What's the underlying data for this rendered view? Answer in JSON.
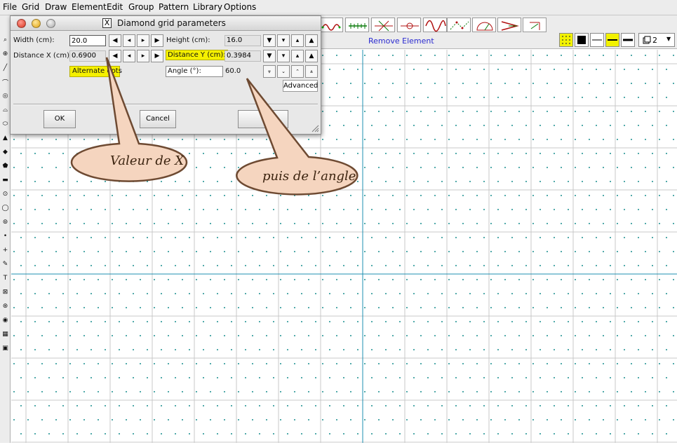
{
  "menu": [
    {
      "label": "File",
      "name": "menu-file"
    },
    {
      "label": "Grid",
      "name": "menu-grid"
    },
    {
      "label": "Draw",
      "name": "menu-draw"
    },
    {
      "label": "Element",
      "name": "menu-element"
    },
    {
      "label": "Edit",
      "name": "menu-edit"
    },
    {
      "label": "Group",
      "name": "menu-group"
    },
    {
      "label": "Pattern",
      "name": "menu-pattern"
    },
    {
      "label": "Library",
      "name": "menu-library"
    },
    {
      "label": "Options",
      "name": "menu-options"
    }
  ],
  "toolbar": {
    "remove_element": "Remove Element",
    "layer_value": "2",
    "tool_icons": [
      "wave-path-icon",
      "measure-ruler-icon",
      "scissors-cross-icon",
      "circle-point-icon",
      "sine-wave-icon",
      "dotted-path-icon",
      "protractor-icon",
      "arrow-shape-icon",
      "arrow-snap-icon"
    ],
    "line_styles": [
      "dot-grid-style-icon",
      "solid-fill-style-icon",
      "thin-line-style-icon",
      "highlight-line-style-icon",
      "thick-line-style-icon"
    ]
  },
  "left_tools": [
    "zoom-icon",
    "select-icon",
    "line-icon",
    "curve-icon",
    "spiral-icon",
    "arc-icon",
    "ellipse-icon",
    "triangle-icon",
    "diamond-icon",
    "polygon-icon",
    "rectangle-icon",
    "circle-icon",
    "oval-icon",
    "node-icon",
    "dot-icon",
    "plus-icon",
    "pen-icon",
    "text-icon",
    "transform-icon",
    "target-icon",
    "spiral-pattern-icon",
    "checker-icon",
    "grid-pattern-icon"
  ],
  "dialog": {
    "x_badge": "X",
    "title": "Diamond grid parameters",
    "width_label": "Width (cm):",
    "width_value": "20.0",
    "height_label": "Height (cm):",
    "height_value": "16.0",
    "distx_label": "Distance X (cm):",
    "distx_value": "0.6900",
    "disty_label": "Distance Y (cm):",
    "disty_value": "0.3984",
    "alternate_label": "Alternate dots",
    "angle_label": "Angle (°):",
    "angle_value": "60.0",
    "advanced_label": "Advanced",
    "ok_label": "OK",
    "cancel_label": "Cancel",
    "help_label": "?"
  },
  "annotations": {
    "callout_x": "Valeur de X",
    "callout_angle": "puis de l’angle"
  },
  "colors": {
    "grid_line": "#c8c8c8",
    "grid_axis": "#1e8fb0",
    "grid_dot": "#1a8f8f",
    "highlight": "#f5f000",
    "callout_fill": "#f6d8c4",
    "callout_stroke": "#6e4a32"
  }
}
